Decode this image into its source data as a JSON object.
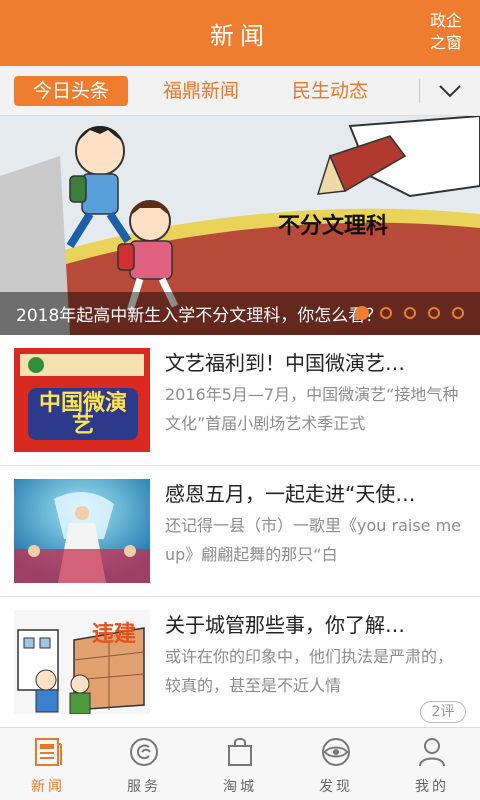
{
  "header": {
    "title": "新闻",
    "right_link": "政企之窗"
  },
  "tabs": [
    {
      "label": "今日头条",
      "active": true
    },
    {
      "label": "福鼎新闻",
      "active": false
    },
    {
      "label": "民生动态",
      "active": false
    }
  ],
  "banner": {
    "caption": "2018年起高中新生入学不分文理科，你怎么看？",
    "image_text": "不分文理科",
    "slide_count": 5,
    "current_slide": 1
  },
  "news": [
    {
      "title": "文艺福利到！中国微演艺…",
      "summary": "2016年5月—7月，中国微演艺“接地气种文化”首届小剧场艺术季正式",
      "thumb_text": "中国微演艺"
    },
    {
      "title": "感恩五月，一起走进“天使…",
      "summary": "还记得一县（市）一歌里《you raise me up》翩翩起舞的那只“白",
      "thumb_text": ""
    },
    {
      "title": "关于城管那些事，你了解…",
      "summary": "或许在你的印象中，他们执法是严肃的，较真的，甚至是不近人情",
      "thumb_text": "违建",
      "comments": "2评"
    }
  ],
  "bottom_nav": [
    {
      "label": "新闻",
      "icon": "news-icon",
      "active": true
    },
    {
      "label": "服务",
      "icon": "service-icon",
      "active": false
    },
    {
      "label": "淘城",
      "icon": "shopping-bag-icon",
      "active": false
    },
    {
      "label": "发现",
      "icon": "discover-eye-icon",
      "active": false
    },
    {
      "label": "我的",
      "icon": "user-icon",
      "active": false
    }
  ],
  "colors": {
    "accent": "#ee7d2f",
    "text": "#222222",
    "muted": "#8d8d8d"
  }
}
